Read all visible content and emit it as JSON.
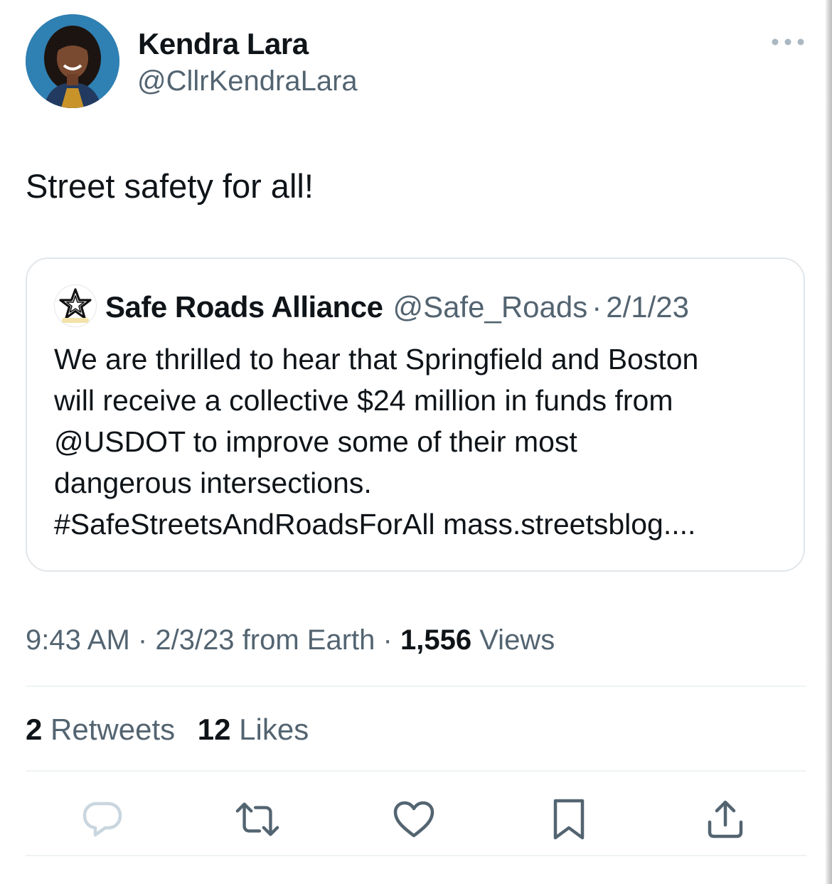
{
  "author": {
    "name": "Kendra Lara",
    "handle": "@CllrKendraLara"
  },
  "tweet": {
    "text": "Street safety for all!"
  },
  "quoted_tweet": {
    "name": "Safe Roads Alliance",
    "handle": "@Safe_Roads",
    "separator": "·",
    "date": "2/1/23",
    "body_lines": [
      "We are thrilled to hear that Springfield and Boston",
      "will receive a collective $24 million in funds from",
      "@USDOT  to improve some of their most",
      "dangerous intersections.",
      "#SafeStreetsAndRoadsForAll mass.streetsblog...."
    ]
  },
  "meta": {
    "time": "9:43 AM",
    "separator": "·",
    "date": "2/3/23",
    "source": "from Earth",
    "views_count": "1,556",
    "views_label": "Views"
  },
  "stats": {
    "retweets_count": "2",
    "retweets_label": "Retweets",
    "likes_count": "12",
    "likes_label": "Likes"
  },
  "actions": [
    {
      "icon": "reply-icon"
    },
    {
      "icon": "retweet-icon"
    },
    {
      "icon": "like-icon"
    },
    {
      "icon": "bookmark-icon"
    },
    {
      "icon": "share-icon"
    }
  ],
  "colors": {
    "text_primary": "#0f1419",
    "text_secondary": "#536471",
    "border": "#e1e6ea",
    "divider": "#eff3f4",
    "icon": "#536471",
    "reply_icon_faded": "#c9d6df"
  }
}
